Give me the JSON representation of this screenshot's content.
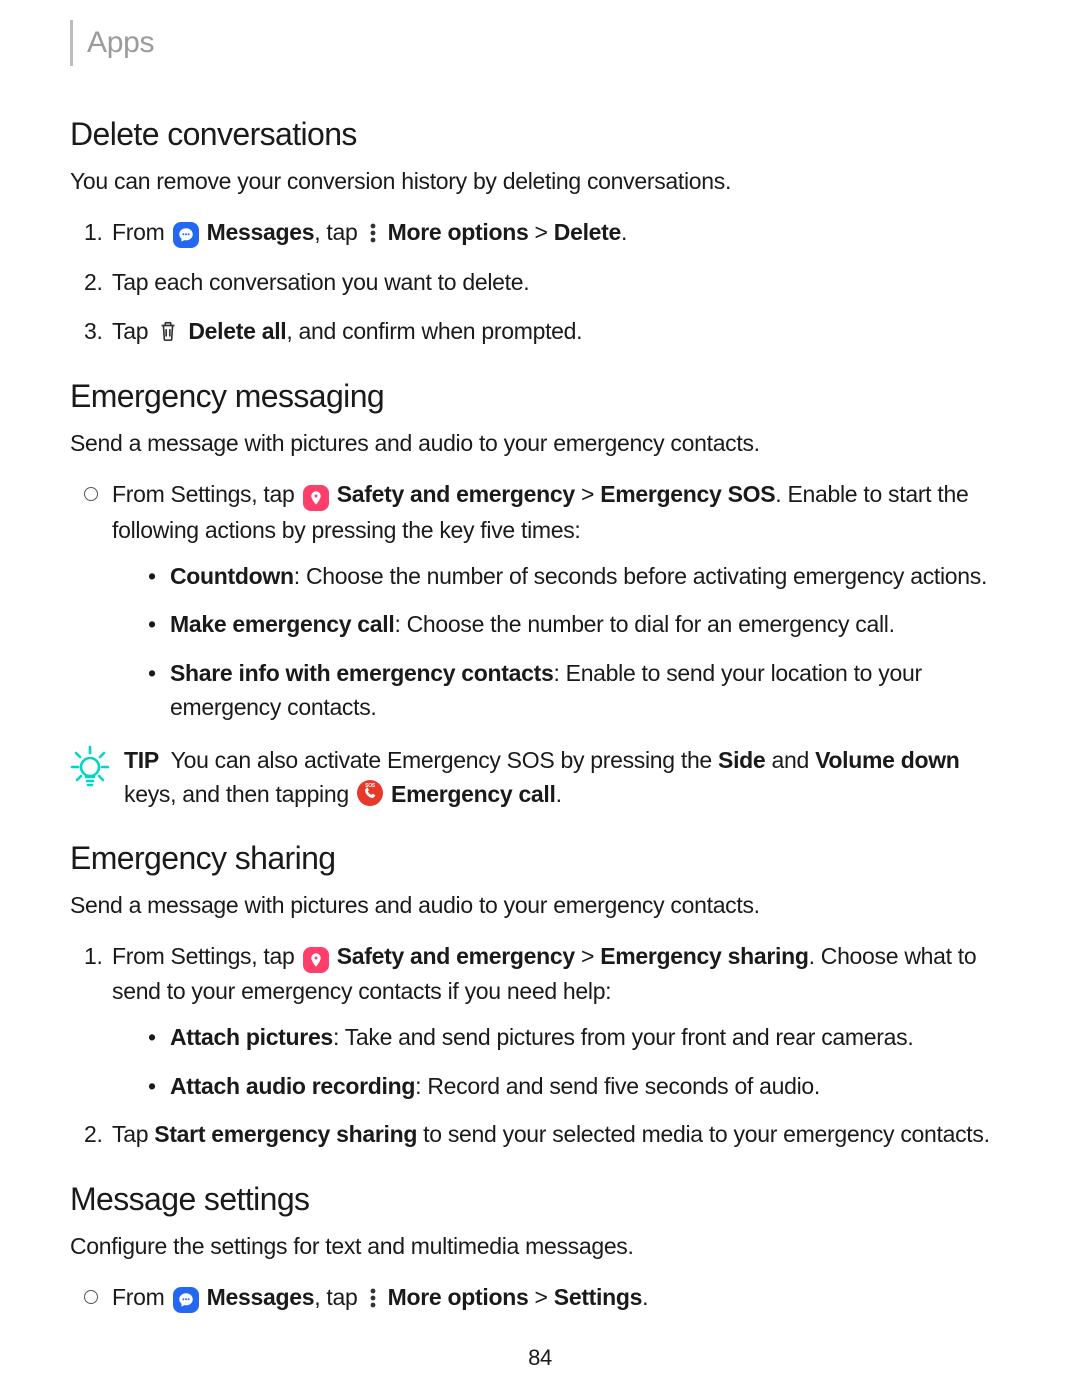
{
  "breadcrumb": "Apps",
  "pageNumber": "84",
  "labels": {
    "more_options": "More options",
    "messages_app": "Messages",
    "tap_word": ", tap",
    "from_word": "From",
    "gt": ">",
    "tip_word": "TIP"
  },
  "s1": {
    "heading": "Delete conversations",
    "intro": "You can remove your conversion history by deleting conversations.",
    "li1_delete": "Delete",
    "li1_suffix": ".",
    "li2": "Tap each conversation you want to delete.",
    "li3_pre": "Tap",
    "li3_bold": "Delete all",
    "li3_post": ", and confirm when prompted."
  },
  "s2": {
    "heading": "Emergency messaging",
    "intro": "Send a message with pictures and audio to your emergency contacts.",
    "li1_pre": "From Settings, tap",
    "li1_b1": "Safety and emergency",
    "li1_b2": "Emergency SOS",
    "li1_post": ". Enable to start the following actions by pressing the key five times:",
    "sub1_b": "Countdown",
    "sub1_t": ": Choose the number of seconds before activating emergency actions.",
    "sub2_b": "Make emergency call",
    "sub2_t": ": Choose the number to dial for an emergency call.",
    "sub3_b": "Share info with emergency contacts",
    "sub3_t": ": Enable to send your location to your emergency contacts.",
    "tip_t1": "You can also activate Emergency SOS by pressing the ",
    "tip_b1": "Side",
    "tip_t2": " and ",
    "tip_b2": "Volume down",
    "tip_t3": " keys, and then tapping",
    "tip_b3": "Emergency call",
    "tip_suffix": "."
  },
  "s3": {
    "heading": "Emergency sharing",
    "intro": "Send a message with pictures and audio to your emergency contacts.",
    "li1_pre": "From Settings, tap",
    "li1_b1": "Safety and emergency",
    "li1_b2": "Emergency sharing",
    "li1_post": ". Choose what to send to your emergency contacts if you need help:",
    "sub1_b": "Attach pictures",
    "sub1_t": ": Take and send pictures from your front and rear cameras.",
    "sub2_b": "Attach audio recording",
    "sub2_t": ": Record and send five seconds of audio.",
    "li2_t1": "Tap ",
    "li2_b1": "Start emergency sharing",
    "li2_t2": " to send your selected media to your emergency contacts."
  },
  "s4": {
    "heading": "Message settings",
    "intro": "Configure the settings for text and multimedia messages.",
    "li1_settings": "Settings",
    "li1_suffix": "."
  }
}
